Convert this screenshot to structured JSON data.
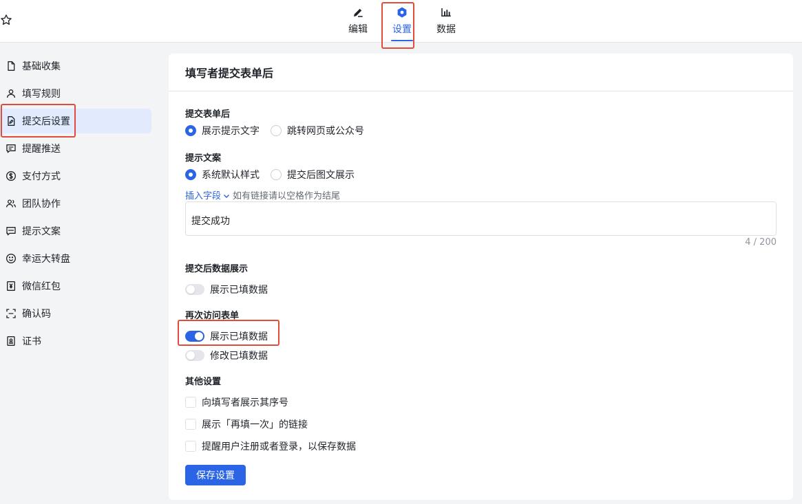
{
  "topbar": {
    "tabs": [
      {
        "label": "编辑",
        "icon": "pen-icon",
        "active": false
      },
      {
        "label": "设置",
        "icon": "hexagon-settings-icon",
        "active": true
      },
      {
        "label": "数据",
        "icon": "bar-chart-icon",
        "active": false
      }
    ]
  },
  "sidebar": {
    "items": [
      {
        "label": "基础收集",
        "icon": "file-icon"
      },
      {
        "label": "填写规则",
        "icon": "user-icon"
      },
      {
        "label": "提交后设置",
        "icon": "file-edit-icon",
        "active": true
      },
      {
        "label": "提醒推送",
        "icon": "message-icon"
      },
      {
        "label": "支付方式",
        "icon": "dollar-icon"
      },
      {
        "label": "团队协作",
        "icon": "users-icon"
      },
      {
        "label": "提示文案",
        "icon": "chat-dots-icon"
      },
      {
        "label": "幸运大转盘",
        "icon": "smile-icon"
      },
      {
        "label": "微信红包",
        "icon": "yen-icon"
      },
      {
        "label": "确认码",
        "icon": "scan-icon"
      },
      {
        "label": "证书",
        "icon": "certificate-icon"
      }
    ]
  },
  "card": {
    "title": "填写者提交表单后",
    "after_submit": {
      "title": "提交表单后",
      "options": [
        "展示提示文字",
        "跳转网页或公众号"
      ],
      "selected": 0
    },
    "prompt_copy": {
      "title": "提示文案",
      "options": [
        "系统默认样式",
        "提交后图文展示"
      ],
      "selected": 0,
      "insert_field": "插入字段",
      "hint": "如有链接请以空格作为结尾",
      "text_value": "提交成功",
      "counter": "4 / 200"
    },
    "data_display": {
      "title": "提交后数据展示",
      "switch_label": "展示已填数据",
      "on": false
    },
    "revisit": {
      "title": "再次访问表单",
      "switches": [
        {
          "label": "展示已填数据",
          "on": true
        },
        {
          "label": "修改已填数据",
          "on": false
        }
      ]
    },
    "other": {
      "title": "其他设置",
      "checks": [
        {
          "label": "向填写者展示其序号",
          "checked": false
        },
        {
          "label": "展示「再填一次」的链接",
          "checked": false
        },
        {
          "label": "提醒用户注册或者登录，以保存数据",
          "checked": false
        }
      ]
    },
    "save_label": "保存设置"
  },
  "colors": {
    "accent": "#2b65e6",
    "highlight_box": "#e14b3b",
    "active_bg": "#e1ebfd"
  }
}
